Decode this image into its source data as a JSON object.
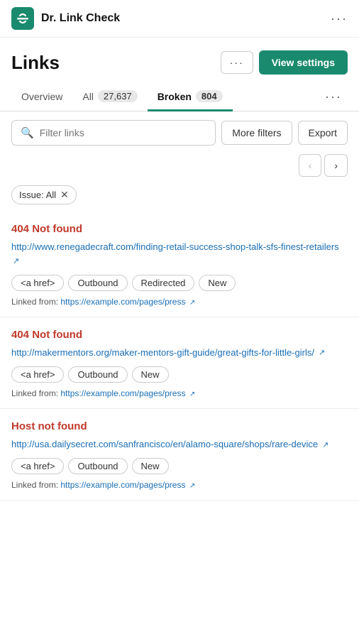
{
  "app": {
    "title": "Dr. Link Check"
  },
  "header": {
    "page_title": "Links",
    "btn_more_label": "···",
    "btn_view_settings_label": "View settings"
  },
  "tabs": [
    {
      "id": "overview",
      "label": "Overview",
      "badge": null,
      "active": false
    },
    {
      "id": "all",
      "label": "All",
      "badge": "27,637",
      "active": false
    },
    {
      "id": "broken",
      "label": "Broken",
      "badge": "804",
      "active": true
    }
  ],
  "filters": {
    "search_placeholder": "Filter links",
    "more_filters_label": "More filters",
    "export_label": "Export"
  },
  "pagination": {
    "prev_label": "‹",
    "next_label": "›"
  },
  "active_filter": {
    "label": "Issue: All",
    "close": "✕"
  },
  "results": [
    {
      "error_type": "404 Not found",
      "url": "http://www.renegadecraft.com/finding-retail-success-shop-talk-sfs-finest-retailers",
      "tags": [
        "<a href>",
        "Outbound",
        "Redirected",
        "New"
      ],
      "linked_from_label": "Linked from:",
      "linked_from_url": "https://example.com/pages/press"
    },
    {
      "error_type": "404 Not found",
      "url": "http://makermentors.org/maker-mentors-gift-guide/great-gifts-for-little-girls/",
      "tags": [
        "<a href>",
        "Outbound",
        "New"
      ],
      "linked_from_label": "Linked from:",
      "linked_from_url": "https://example.com/pages/press"
    },
    {
      "error_type": "Host not found",
      "url": "http://usa.dailysecret.com/sanfrancisco/en/alamo-square/shops/rare-device",
      "tags": [
        "<a href>",
        "Outbound",
        "New"
      ],
      "linked_from_label": "Linked from:",
      "linked_from_url": "https://example.com/pages/press"
    }
  ]
}
